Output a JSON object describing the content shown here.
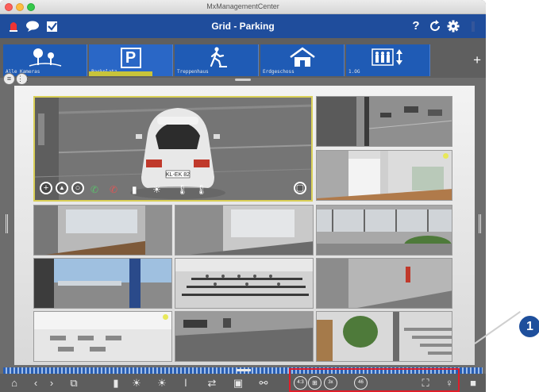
{
  "window": {
    "title": "MxManagementCenter"
  },
  "toolbar": {
    "title": "Grid - Parking",
    "icons": [
      "alarm-bell-icon",
      "chat-icon",
      "checkbox-icon",
      "help-icon",
      "refresh-icon",
      "settings-icon",
      "signal-icon"
    ],
    "help_glyph": "?"
  },
  "tabs": [
    {
      "label": "Alle Kameras",
      "icon": "trees-icon"
    },
    {
      "label": "Parkplatz",
      "icon": "parking-icon",
      "active": true,
      "glyph": "P"
    },
    {
      "label": "Treppenhaus",
      "icon": "walking-person-icon"
    },
    {
      "label": "Erdgeschoss",
      "icon": "house-icon"
    },
    {
      "label": "1.OG",
      "icon": "people-elevator-icon"
    }
  ],
  "add_tab_glyph": "+",
  "cameras": {
    "selected_plate": "KL-EK 82",
    "overlay_labels": {
      "zoom_in": "+",
      "mountain": "▲",
      "circle": "○",
      "screen": "▢"
    }
  },
  "bottombar": {
    "zoom_4_3": "4:3",
    "zoom_3x": "3x",
    "zoom_46": "46",
    "icons": [
      "home-icon",
      "back-icon",
      "forward-icon",
      "layout-icon",
      "door-icon",
      "sun-low-icon",
      "sun-high-icon",
      "thermometer-icon",
      "switch-icon",
      "snapshot-icon",
      "link-icon",
      "fullscreen-icon",
      "pin-icon",
      "lock-icon"
    ]
  },
  "callout": {
    "number": "1"
  },
  "colors": {
    "toolbar": "#1f4d9c",
    "tab": "#1f5bb5",
    "highlight": "#e01e2a",
    "callout": "#1e4f9c"
  }
}
